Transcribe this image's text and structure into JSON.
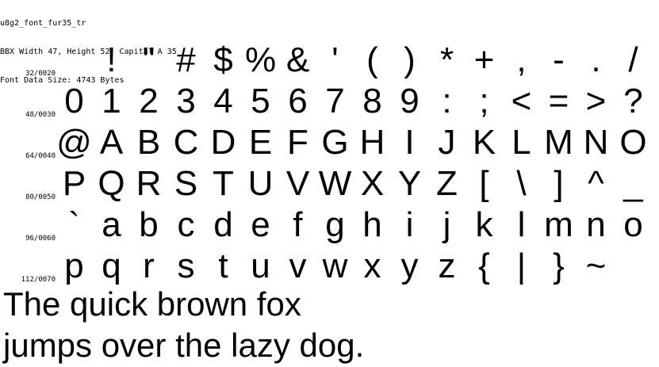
{
  "header": {
    "line1": "u8g2_font_fur35_tr",
    "line2": "BBX Width 47, Height 52, Capital A 35",
    "line3": "Font Data Size: 4743 Bytes"
  },
  "rows": [
    {
      "label": "32/0020",
      "glyphs": [
        " ",
        "!",
        "\"",
        "#",
        "$",
        "%",
        "&",
        "'",
        "(",
        ")",
        "*",
        "+",
        ",",
        "-",
        ".",
        "/"
      ]
    },
    {
      "label": "48/0030",
      "glyphs": [
        "0",
        "1",
        "2",
        "3",
        "4",
        "5",
        "6",
        "7",
        "8",
        "9",
        ":",
        ";",
        "<",
        "=",
        ">",
        "?"
      ]
    },
    {
      "label": "64/0040",
      "glyphs": [
        "@",
        "A",
        "B",
        "C",
        "D",
        "E",
        "F",
        "G",
        "H",
        "I",
        "J",
        "K",
        "L",
        "M",
        "N",
        "O"
      ]
    },
    {
      "label": "80/0050",
      "glyphs": [
        "P",
        "Q",
        "R",
        "S",
        "T",
        "U",
        "V",
        "W",
        "X",
        "Y",
        "Z",
        "[",
        "\\",
        "]",
        "^",
        "_"
      ]
    },
    {
      "label": "96/0060",
      "glyphs": [
        "`",
        "a",
        "b",
        "c",
        "d",
        "e",
        "f",
        "g",
        "h",
        "i",
        "j",
        "k",
        "l",
        "m",
        "n",
        "o"
      ]
    },
    {
      "label": "112/0070",
      "glyphs": [
        "p",
        "q",
        "r",
        "s",
        "t",
        "u",
        "v",
        "w",
        "x",
        "y",
        "z",
        "{",
        "|",
        "}",
        "~"
      ]
    }
  ],
  "pangram": {
    "line1": "The quick brown fox",
    "line2": "jumps over the lazy dog."
  }
}
